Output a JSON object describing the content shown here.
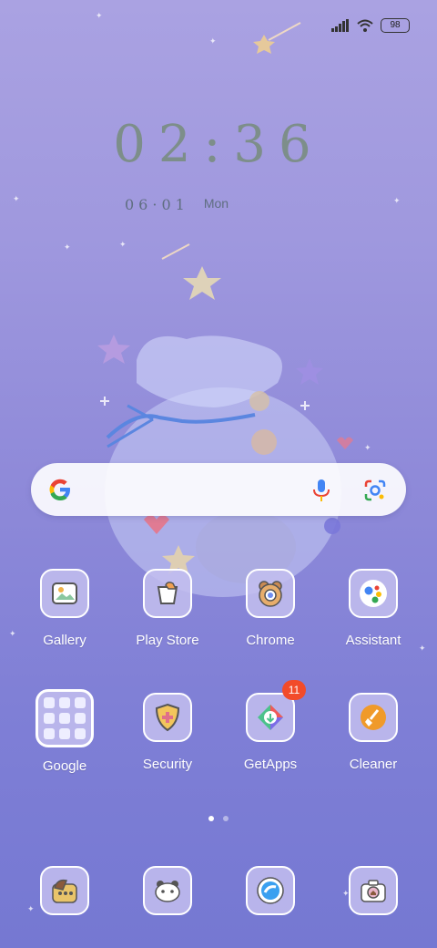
{
  "status_bar": {
    "battery": "98"
  },
  "clock": {
    "time": "02:36",
    "date": "06·01",
    "weekday": "Mon"
  },
  "search_bar": {
    "icons": [
      "google-logo",
      "microphone-icon",
      "lens-icon"
    ]
  },
  "apps": [
    {
      "label": "Gallery",
      "icon": "gallery-icon"
    },
    {
      "label": "Play Store",
      "icon": "play-store-icon"
    },
    {
      "label": "Chrome",
      "icon": "chrome-icon"
    },
    {
      "label": "Assistant",
      "icon": "assistant-icon"
    },
    {
      "label": "Google",
      "icon": "folder-icon"
    },
    {
      "label": "Security",
      "icon": "security-icon"
    },
    {
      "label": "GetApps",
      "icon": "getapps-icon",
      "badge": "11"
    },
    {
      "label": "Cleaner",
      "icon": "cleaner-icon"
    }
  ],
  "page_indicator": {
    "pages": 2,
    "current": 1
  },
  "dock": [
    {
      "icon": "phone-icon"
    },
    {
      "icon": "messages-icon"
    },
    {
      "icon": "browser-icon"
    },
    {
      "icon": "camera-icon"
    }
  ],
  "colors": {
    "badge": "#f24b2a",
    "clock": "#7d8e8a"
  }
}
